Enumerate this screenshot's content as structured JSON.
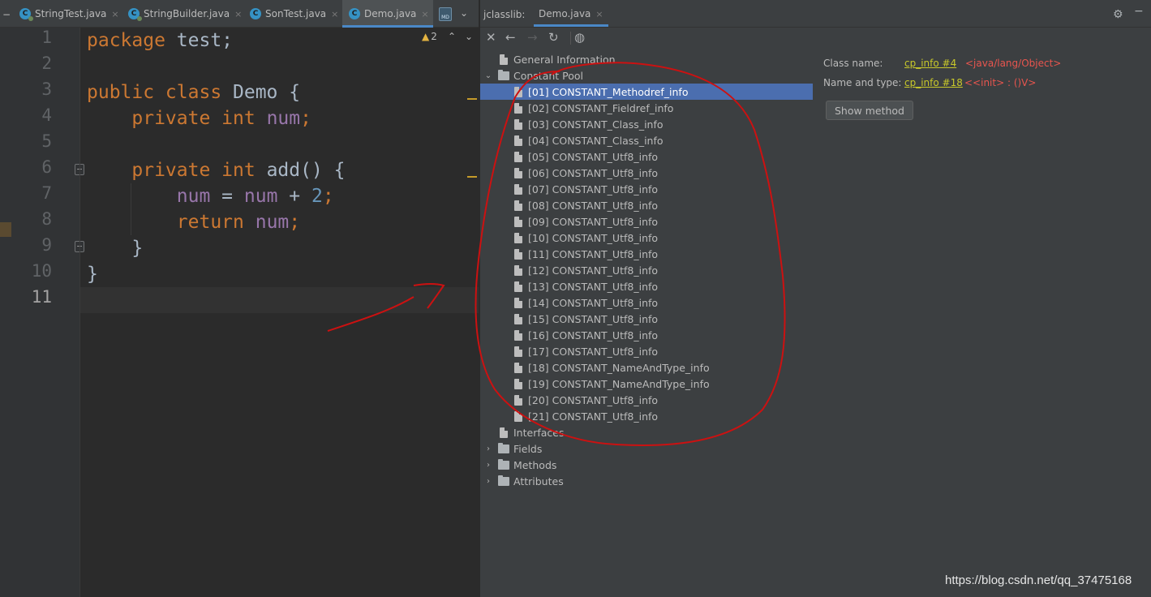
{
  "editor": {
    "tabs": [
      {
        "label": "StringTest.java",
        "icon": "java-class-icon",
        "active": false
      },
      {
        "label": "StringBuilder.java",
        "icon": "java-class-icon",
        "active": false
      },
      {
        "label": "SonTest.java",
        "icon": "java-class-icon",
        "active": false
      },
      {
        "label": "Demo.java",
        "icon": "java-class-icon",
        "active": true
      }
    ],
    "tab_close": "×",
    "warning_count": "2",
    "line_numbers": [
      "1",
      "2",
      "3",
      "4",
      "5",
      "6",
      "7",
      "8",
      "9",
      "10",
      "11"
    ],
    "current_line": "11",
    "code": {
      "l1_kw": "package",
      "l1_rest": " test;",
      "l3_kw": "public class",
      "l3_name": " Demo",
      "l3_rest": " {",
      "l4_kw": "private int",
      "l4_field": " num",
      "l4_rest": ";",
      "l6_kw": "private int",
      "l6_method": " add",
      "l6_rest": "() {",
      "l7_field1": "num",
      "l7_op": " = ",
      "l7_field2": "num",
      "l7_op2": " + ",
      "l7_num": "2",
      "l7_semi": ";",
      "l8_kw": "return",
      "l8_field": " num",
      "l8_semi": ";",
      "l9_brace": "}",
      "l10_brace": "}"
    }
  },
  "jclasslib": {
    "label": "jclasslib:",
    "tab_label": "Demo.java",
    "tree": {
      "general_information": "General Information",
      "constant_pool": "Constant Pool",
      "constant_pool_items": [
        "[01] CONSTANT_Methodref_info",
        "[02] CONSTANT_Fieldref_info",
        "[03] CONSTANT_Class_info",
        "[04] CONSTANT_Class_info",
        "[05] CONSTANT_Utf8_info",
        "[06] CONSTANT_Utf8_info",
        "[07] CONSTANT_Utf8_info",
        "[08] CONSTANT_Utf8_info",
        "[09] CONSTANT_Utf8_info",
        "[10] CONSTANT_Utf8_info",
        "[11] CONSTANT_Utf8_info",
        "[12] CONSTANT_Utf8_info",
        "[13] CONSTANT_Utf8_info",
        "[14] CONSTANT_Utf8_info",
        "[15] CONSTANT_Utf8_info",
        "[16] CONSTANT_Utf8_info",
        "[17] CONSTANT_Utf8_info",
        "[18] CONSTANT_NameAndType_info",
        "[19] CONSTANT_NameAndType_info",
        "[20] CONSTANT_Utf8_info",
        "[21] CONSTANT_Utf8_info"
      ],
      "selected_index": 0,
      "interfaces": "Interfaces",
      "fields": "Fields",
      "methods": "Methods",
      "attributes": "Attributes"
    },
    "details": {
      "class_name_label": "Class name:",
      "class_name_link": "cp_info #4",
      "class_name_value": "<java/lang/Object>",
      "name_type_label": "Name and type:",
      "name_type_link": "cp_info #18",
      "name_type_value": "<<init> : ()V>",
      "show_method_button": "Show method"
    }
  },
  "watermark": "https://blog.csdn.net/qq_37475168",
  "colors": {
    "keyword": "#cc7832",
    "field": "#9876aa",
    "number": "#6897bb",
    "selection": "#4b6eaf",
    "link": "#c8c82a",
    "value_red": "#e8554e",
    "annotation_red": "#cc1111"
  }
}
